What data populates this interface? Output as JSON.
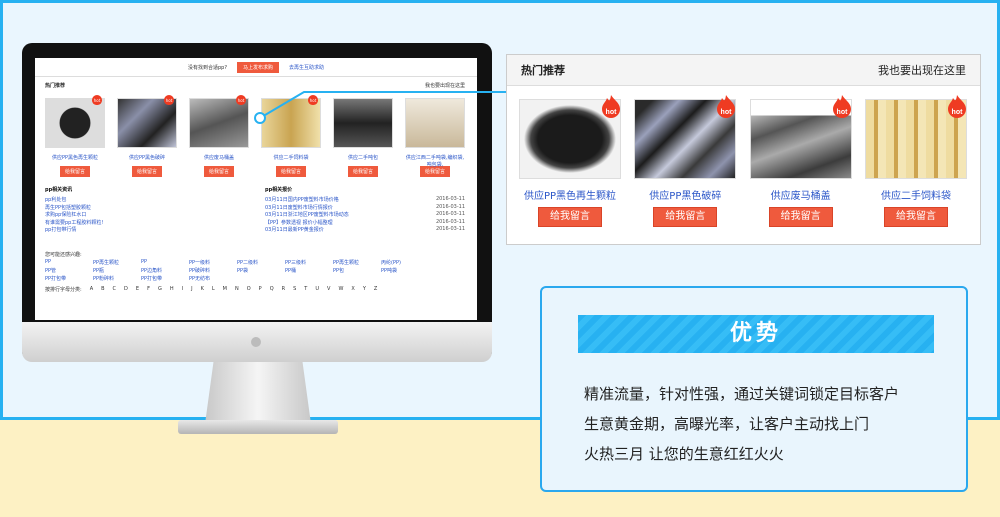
{
  "screen": {
    "topbar": {
      "question": "没有找到合适pp?",
      "cta": "马上发布求购",
      "link": "去再生互助求助"
    },
    "hot": {
      "title": "热门推荐",
      "right": "我也要出现在这里"
    },
    "items": [
      {
        "name": "供应PP黑色再生颗粒",
        "btn": "给我留言"
      },
      {
        "name": "供应PP黑色破碎",
        "btn": "给我留言"
      },
      {
        "name": "供应废马桶盖",
        "btn": "给我留言"
      },
      {
        "name": "供应二手饲料袋",
        "btn": "给我留言"
      },
      {
        "name": "供应二手吨包",
        "btn": "给我留言"
      },
      {
        "name": "供应江西二手吨袋,编织袋,吨包袋,",
        "btn": "给我留言"
      }
    ],
    "news": {
      "title": "pp相关资讯",
      "rows": [
        "pp利处包",
        "再生PP包括塑胶颗粒",
        "求购pp保险杠水口",
        "有谁需要pp工程胶料颗粒!",
        "pp打包带行情"
      ]
    },
    "prices": {
      "title": "pp相关报价",
      "rows": [
        {
          "t": "03月11日国内PP废塑料市场价格",
          "d": "2016-03-11"
        },
        {
          "t": "03月11日废塑料市场行情报价",
          "d": "2016-03-11"
        },
        {
          "t": "03月11日浙江地区PP废塑料市场动态",
          "d": "2016-03-11"
        },
        {
          "t": "【PP】参数透视 报价小幅整理",
          "d": "2016-03-11"
        },
        {
          "t": "03月11日最新PP黄金报价",
          "d": "2016-03-11"
        }
      ]
    },
    "tags_title": "您可能还感兴趣:",
    "tags": [
      [
        "PP",
        "PP再生颗粒",
        "PP",
        "PP一级料",
        "PP二级料",
        "PP三级料",
        "PP再生颗粒",
        "丙纶(PP)"
      ],
      [
        "PP管",
        "PP瓶",
        "PP边角料",
        "PP破碎料",
        "PP袋",
        "PP桶",
        "PP包",
        "PP吨袋"
      ],
      [
        "PP打包带",
        "PP粉碎料",
        "PP打包带",
        "PP无纺布",
        "",
        "",
        "",
        ""
      ]
    ],
    "alpha_label": "按排行字母分类:",
    "letters": [
      "A",
      "B",
      "C",
      "D",
      "E",
      "F",
      "G",
      "H",
      "I",
      "J",
      "K",
      "L",
      "M",
      "N",
      "O",
      "P",
      "Q",
      "R",
      "S",
      "T",
      "U",
      "V",
      "W",
      "X",
      "Y",
      "Z"
    ]
  },
  "callout": {
    "title": "热门推荐",
    "right": "我也要出现在这里",
    "items": [
      {
        "name": "供应PP黑色再生颗粒",
        "btn": "给我留言",
        "hot": "hot"
      },
      {
        "name": "供应PP黑色破碎",
        "btn": "给我留言",
        "hot": "hot"
      },
      {
        "name": "供应废马桶盖",
        "btn": "给我留言",
        "hot": "hot"
      },
      {
        "name": "供应二手饲料袋",
        "btn": "给我留言",
        "hot": "hot"
      }
    ]
  },
  "advantage": {
    "title": "优势",
    "lines": [
      "精准流量，针对性强，通过关键词锁定目标客户",
      "生意黄金期，高曝光率，让客户主动找上门",
      "火热三月 让您的生意红红火火"
    ]
  },
  "colors": {
    "accent_blue": "#27b1f1",
    "button_red": "#ef5a3d",
    "link_blue": "#2b56c8"
  }
}
